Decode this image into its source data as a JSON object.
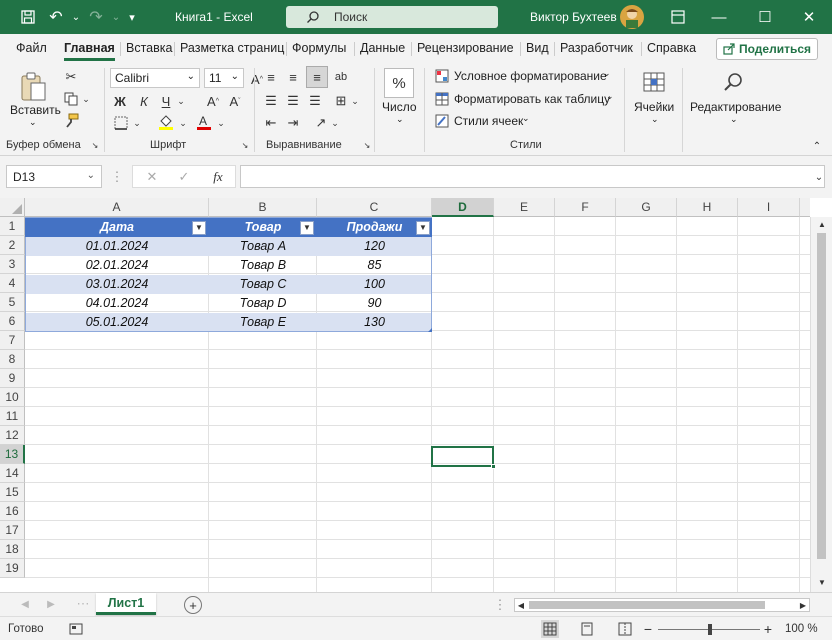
{
  "titlebar": {
    "document_title": "Книга1  -  Excel",
    "search_placeholder": "Поиск",
    "username": "Виктор Бухтеев"
  },
  "tabs": [
    "Файл",
    "Главная",
    "Вставка",
    "Разметка страниц",
    "Формулы",
    "Данные",
    "Рецензирование",
    "Вид",
    "Разработчик",
    "Справка"
  ],
  "active_tab": "Главная",
  "share_label": "Поделиться",
  "ribbon": {
    "paste_label": "Вставить",
    "clipboard_group": "Буфер обмена",
    "font_name": "Calibri",
    "font_size": "11",
    "bold": "Ж",
    "italic": "К",
    "underline": "Ч",
    "font_group": "Шрифт",
    "alignment_group": "Выравнивание",
    "number_label": "Число",
    "conditional_formatting": "Условное форматирование",
    "format_as_table": "Форматировать как таблицу",
    "cell_styles": "Стили ячеек",
    "styles_group": "Стили",
    "cells_label": "Ячейки",
    "editing_label": "Редактирование"
  },
  "formula_bar": {
    "name_box": "D13",
    "fx": "fx",
    "formula": ""
  },
  "grid": {
    "columns": [
      "A",
      "B",
      "C",
      "D",
      "E",
      "F",
      "G",
      "H",
      "I"
    ],
    "rows": [
      "1",
      "2",
      "3",
      "4",
      "5",
      "6",
      "7",
      "8",
      "9",
      "10",
      "11",
      "12",
      "13",
      "14",
      "15",
      "16",
      "17",
      "18",
      "19"
    ],
    "table_headers": [
      "Дата",
      "Товар",
      "Продажи"
    ],
    "table_rows": [
      [
        "01.01.2024",
        "Товар A",
        "120"
      ],
      [
        "02.01.2024",
        "Товар B",
        "85"
      ],
      [
        "03.01.2024",
        "Товар C",
        "100"
      ],
      [
        "04.01.2024",
        "Товар D",
        "90"
      ],
      [
        "05.01.2024",
        "Товар E",
        "130"
      ]
    ],
    "selected_cell": "D13"
  },
  "sheet_tab": "Лист1",
  "status": {
    "text": "Готово",
    "zoom": "100 %"
  },
  "colors": {
    "accent": "#217346",
    "table_header": "#4472c4",
    "table_band": "#d9e1f2"
  }
}
